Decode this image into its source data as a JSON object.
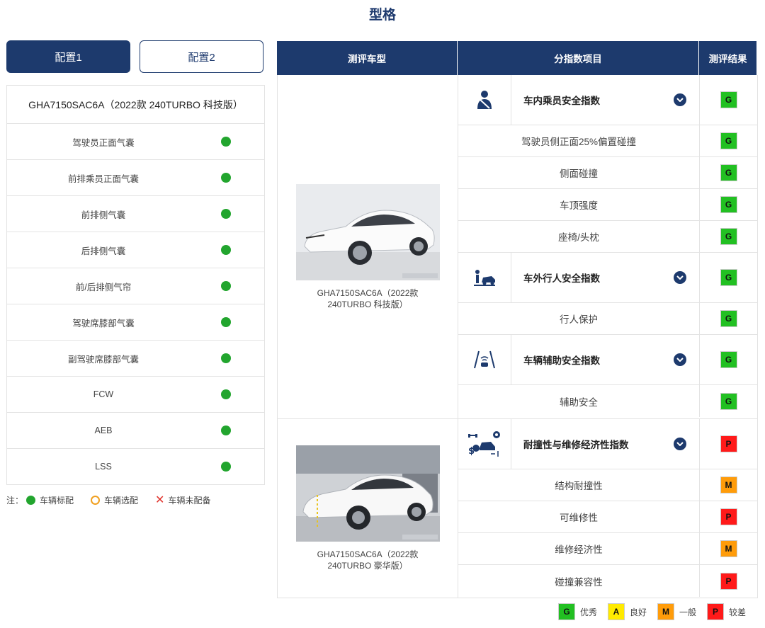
{
  "page_title": "型格",
  "config_tabs": {
    "tab1": "配置1",
    "tab2": "配置2"
  },
  "features": {
    "model": "GHA7150SAC6A（2022款 240TURBO 科技版）",
    "items": [
      "驾驶员正面气囊",
      "前排乘员正面气囊",
      "前排侧气囊",
      "后排侧气囊",
      "前/后排侧气帘",
      "驾驶席膝部气囊",
      "副驾驶席膝部气囊",
      "FCW",
      "AEB",
      "LSS"
    ],
    "status_color": "#22a52e"
  },
  "note": {
    "prefix": "注：",
    "standard": "车辆标配",
    "optional": "车辆选配",
    "none": "车辆未配备"
  },
  "table": {
    "col_model": "测评车型",
    "col_index": "分指数项目",
    "col_result": "测评结果"
  },
  "group1": {
    "caption": "GHA7150SAC6A（2022款 240TURBO 科技版）",
    "occupant": {
      "name": "车内乘员安全指数",
      "grade": "G",
      "icon": "seatbelt-person-icon"
    },
    "occ_subs": [
      {
        "name": "驾驶员侧正面25%偏置碰撞",
        "grade": "G"
      },
      {
        "name": "侧面碰撞",
        "grade": "G"
      },
      {
        "name": "车顶强度",
        "grade": "G"
      },
      {
        "name": "座椅/头枕",
        "grade": "G"
      }
    ],
    "pedestrian": {
      "name": "车外行人安全指数",
      "grade": "G",
      "icon": "pedestrian-car-icon"
    },
    "ped_subs": [
      {
        "name": "行人保护",
        "grade": "G"
      }
    ],
    "assist": {
      "name": "车辆辅助安全指数",
      "grade": "G",
      "icon": "lane-assist-icon"
    },
    "assist_subs": [
      {
        "name": "辅助安全",
        "grade": "G"
      }
    ]
  },
  "group2": {
    "caption": "GHA7150SAC6A（2022款 240TURBO 豪华版）",
    "repair": {
      "name": "耐撞性与维修经济性指数",
      "grade": "P",
      "icon": "repair-cost-icon"
    },
    "repair_subs": [
      {
        "name": "结构耐撞性",
        "grade": "M"
      },
      {
        "name": "可维修性",
        "grade": "P"
      },
      {
        "name": "维修经济性",
        "grade": "M"
      },
      {
        "name": "碰撞兼容性",
        "grade": "P"
      }
    ]
  },
  "legend": {
    "G": "优秀",
    "A": "良好",
    "M": "一般",
    "P": "较差"
  },
  "colors": {
    "navy": "#1d3a6d",
    "G": "#22c022",
    "A": "#ffea00",
    "M": "#ff9c0a",
    "P": "#ff1a1a"
  }
}
